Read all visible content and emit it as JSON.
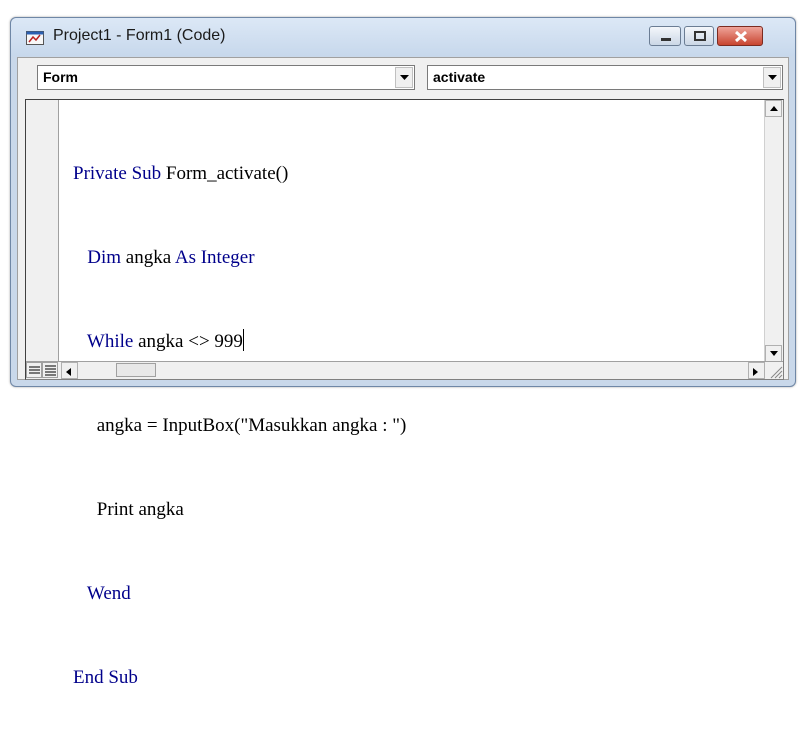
{
  "window": {
    "title": "Project1 - Form1 (Code)",
    "icon": "vb-project-icon",
    "controls": [
      "minimize-icon",
      "maximize-icon",
      "close-icon"
    ]
  },
  "object_combo": {
    "value": "Form",
    "icon": "chevron-down-icon"
  },
  "procedure_combo": {
    "value": "activate",
    "icon": "chevron-down-icon"
  },
  "code": {
    "line1": {
      "kw1": "Private Sub",
      "rest": " Form_activate()"
    },
    "line2": {
      "kw1": "Dim",
      "mid": " angka ",
      "kw2": "As Integer"
    },
    "line3": {
      "kw1": "While",
      "rest": " angka <> 999"
    },
    "line4": {
      "text": "angka = InputBox(\"Masukkan angka : \")"
    },
    "line5": {
      "text": "Print angka"
    },
    "line6": {
      "kw1": "Wend"
    },
    "line7": {
      "kw1": "End Sub"
    }
  },
  "colors": {
    "keyword": "#00008b",
    "text": "#000000",
    "close_button": "#c8452f"
  }
}
